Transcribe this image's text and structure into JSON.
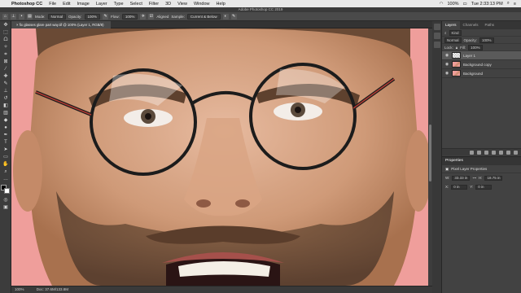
{
  "menubar": {
    "app_name": "Photoshop CC",
    "items": [
      "File",
      "Edit",
      "Image",
      "Layer",
      "Type",
      "Select",
      "Filter",
      "3D",
      "View",
      "Window",
      "Help"
    ],
    "battery": "100%",
    "clock": "Tue 2:33:13 PM"
  },
  "window": {
    "title": "Adobe Photoshop CC 2019"
  },
  "options_bar": {
    "mode_label": "Mode:",
    "mode_value": "Normal",
    "opacity_label": "Opacity:",
    "opacity_value": "100%",
    "flow_label": "Flow:",
    "flow_value": "100%",
    "aligned_label": "Aligned",
    "sample_label": "Sample:",
    "sample_value": "Current & Below"
  },
  "document": {
    "tab_label": "fix glasses glare part way.tif @ 100% (Layer 1, RGB/8)",
    "status_zoom": "100%",
    "status_doc": "Doc: 37.6M/133.8M"
  },
  "layers_panel": {
    "tabs": [
      "Layers",
      "Channels",
      "Paths"
    ],
    "kind_label": "Kind",
    "blend_value": "Normal",
    "opacity_label": "Opacity:",
    "opacity_value": "100%",
    "lock_label": "Lock:",
    "fill_label": "Fill:",
    "fill_value": "100%",
    "layers": [
      {
        "name": "Layer 1",
        "selected": true
      },
      {
        "name": "Background copy",
        "selected": false
      },
      {
        "name": "Background",
        "selected": false
      }
    ]
  },
  "properties_panel": {
    "title": "Properties",
    "subtitle": "Pixel Layer Properties",
    "w_label": "W:",
    "w_value": "33.33 in",
    "h_label": "H:",
    "h_value": "18.75 in",
    "x_label": "X:",
    "x_value": "0 in",
    "y_label": "Y:",
    "y_value": "0 in"
  },
  "colors": {
    "canvas_background": "#ef9e9b",
    "ui_dark": "#3c3c3c",
    "selected_layer": "#5a5a5a"
  }
}
